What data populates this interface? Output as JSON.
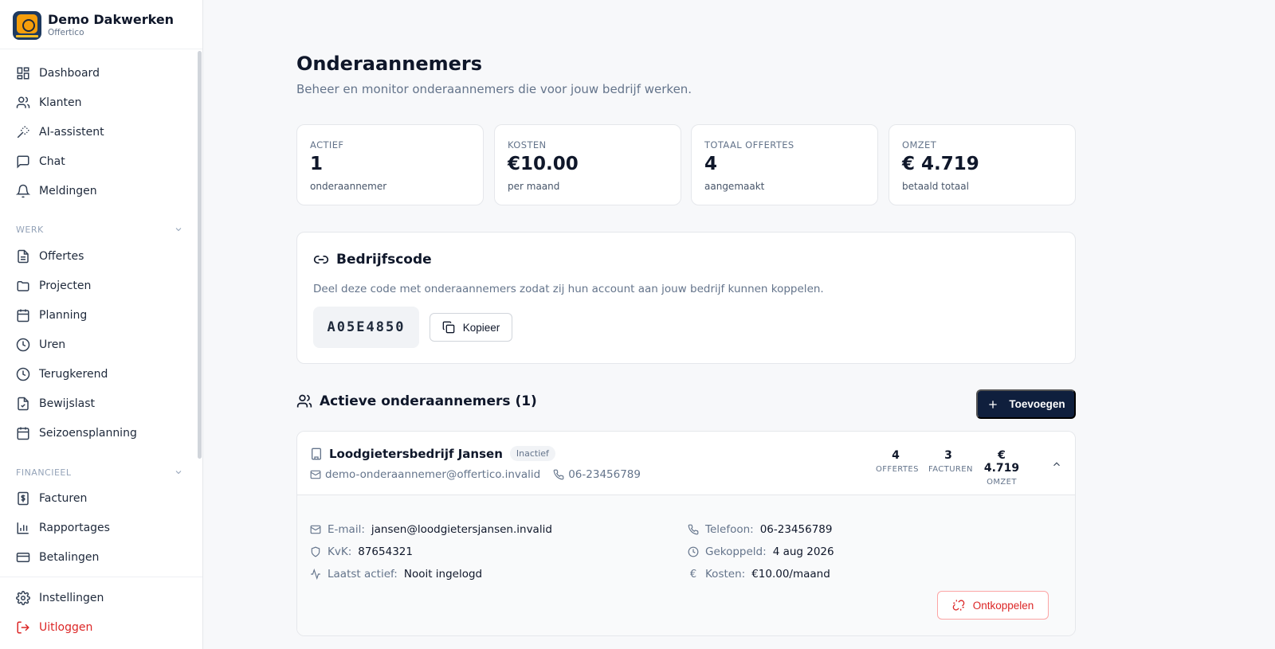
{
  "brand": {
    "name": "Demo Dakwerken",
    "sub": "Offertico"
  },
  "nav": {
    "main": [
      {
        "label": "Dashboard",
        "icon": "dashboard-icon"
      },
      {
        "label": "Klanten",
        "icon": "users-icon"
      },
      {
        "label": "AI-assistent",
        "icon": "wand-icon"
      },
      {
        "label": "Chat",
        "icon": "chat-icon"
      },
      {
        "label": "Meldingen",
        "icon": "bell-icon"
      }
    ],
    "werk_label": "WERK",
    "werk": [
      {
        "label": "Offertes",
        "icon": "file-icon"
      },
      {
        "label": "Projecten",
        "icon": "folder-icon"
      },
      {
        "label": "Planning",
        "icon": "calendar-icon"
      },
      {
        "label": "Uren",
        "icon": "clock-icon"
      },
      {
        "label": "Terugkerend",
        "icon": "clock-icon"
      },
      {
        "label": "Bewijslast",
        "icon": "file-check-icon"
      },
      {
        "label": "Seizoensplanning",
        "icon": "calendar-icon"
      }
    ],
    "financieel_label": "FINANCIEEL",
    "financieel": [
      {
        "label": "Facturen",
        "icon": "invoice-icon"
      },
      {
        "label": "Rapportages",
        "icon": "bar-chart-icon"
      },
      {
        "label": "Betalingen",
        "icon": "credit-card-icon"
      }
    ],
    "settings": "Instellingen",
    "logout": "Uitloggen"
  },
  "page": {
    "title": "Onderaannemers",
    "subtitle": "Beheer en monitor onderaannemers die voor jouw bedrijf werken."
  },
  "stats": [
    {
      "label": "ACTIEF",
      "value": "1",
      "caption": "onderaannemer"
    },
    {
      "label": "KOSTEN",
      "value": "€10.00",
      "caption": "per maand"
    },
    {
      "label": "TOTAAL OFFERTES",
      "value": "4",
      "caption": "aangemaakt"
    },
    {
      "label": "OMZET",
      "value": "€ 4.719",
      "caption": "betaald totaal"
    }
  ],
  "company_code": {
    "title": "Bedrijfscode",
    "description": "Deel deze code met onderaannemers zodat zij hun account aan jouw bedrijf kunnen koppelen.",
    "code": "A05E4850",
    "copy_label": "Kopieer"
  },
  "active": {
    "title": "Actieve onderaannemers (1)",
    "add_label": "Toevoegen"
  },
  "subcontractor": {
    "name": "Loodgietersbedrijf Jansen",
    "status": "Inactief",
    "email": "demo-onderaannemer@offertico.invalid",
    "phone": "06-23456789",
    "metrics": [
      {
        "value": "4",
        "label": "OFFERTES"
      },
      {
        "value": "3",
        "label": "FACTUREN"
      },
      {
        "value": "€ 4.719",
        "label": "OMZET"
      }
    ],
    "details": {
      "email_label": "E-mail:",
      "email_value": "jansen@loodgietersjansen.invalid",
      "kvk_label": "KvK:",
      "kvk_value": "87654321",
      "last_label": "Laatst actief:",
      "last_value": "Nooit ingelogd",
      "phone_label": "Telefoon:",
      "phone_value": "06-23456789",
      "linked_label": "Gekoppeld:",
      "linked_value": "4 aug 2026",
      "cost_symbol": "€",
      "cost_label": "Kosten:",
      "cost_value": "€10.00/maand"
    },
    "disconnect_label": "Ontkoppelen"
  },
  "colors": {
    "primary": "#0f1f3d",
    "danger": "#dc2626",
    "muted": "#64748b"
  }
}
